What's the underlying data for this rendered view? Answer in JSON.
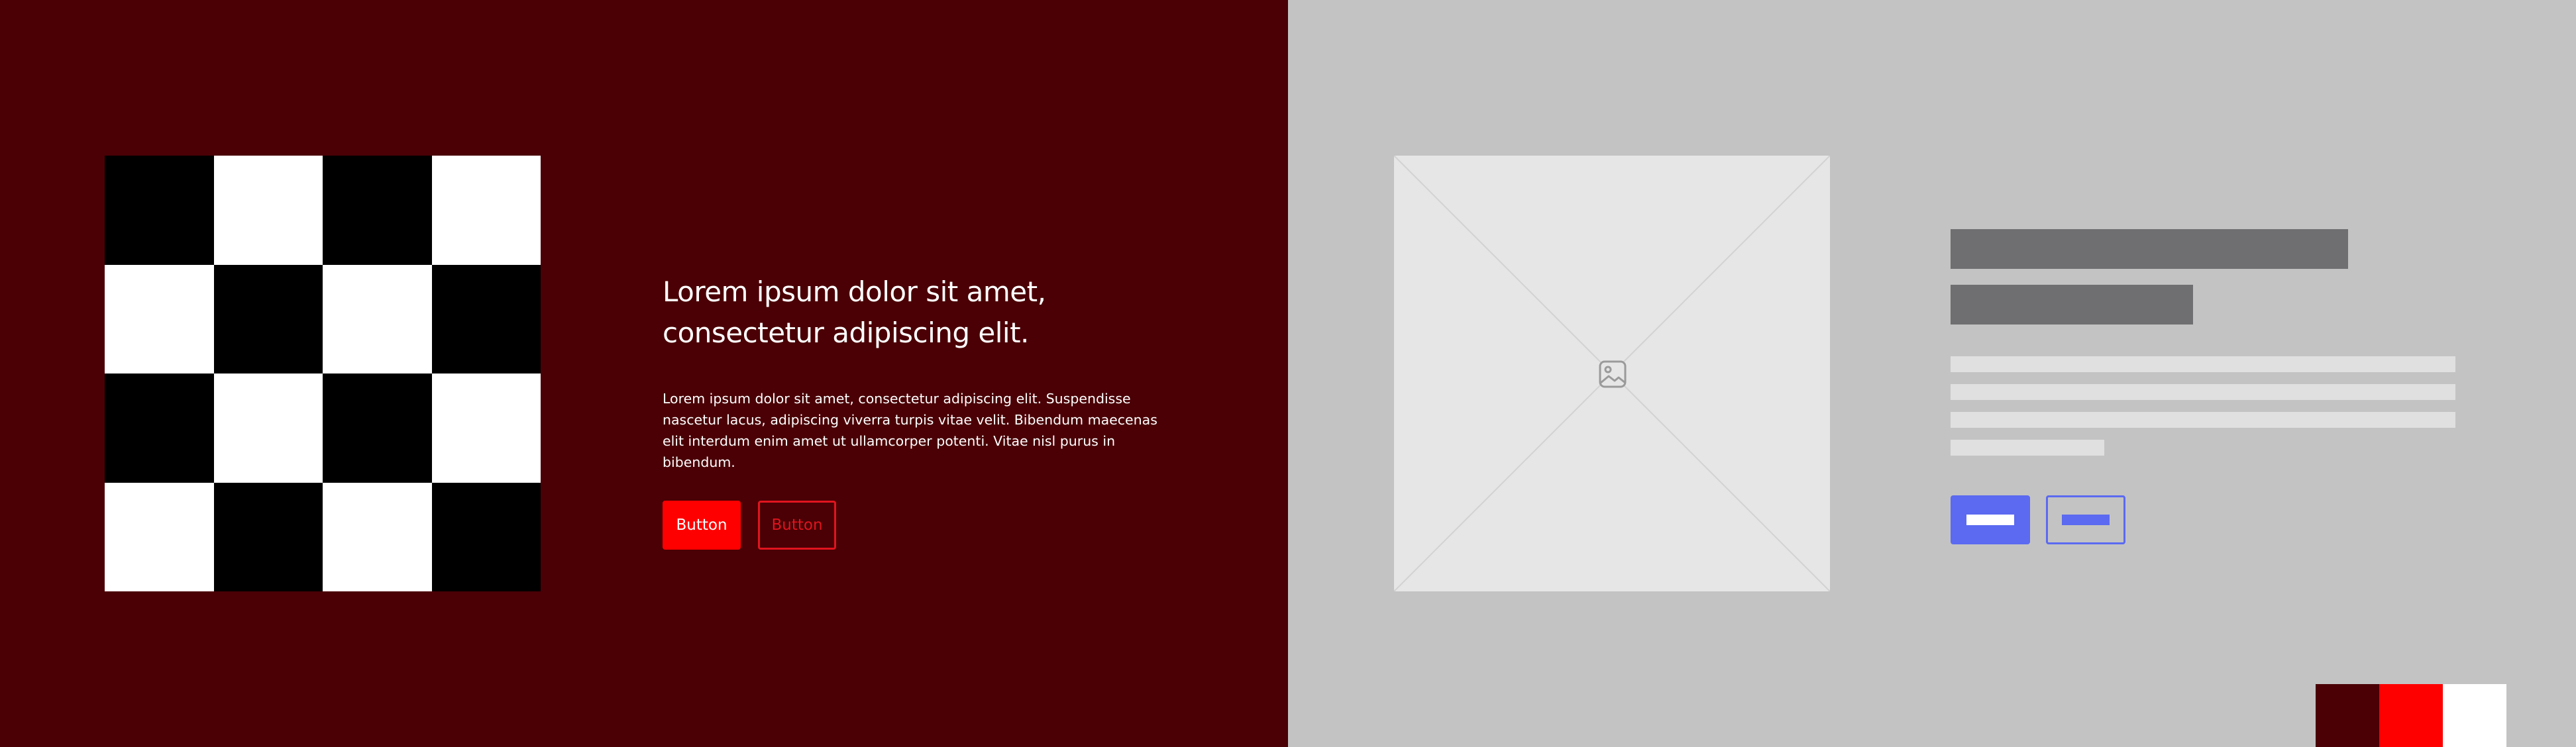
{
  "hero": {
    "headline": "Lorem ipsum dolor sit amet, consectetur adipiscing elit.",
    "body": "Lorem ipsum dolor sit amet, consectetur adipiscing elit. Suspendisse nascetur lacus, adipiscing viverra turpis vitae velit. Bibendum maecenas elit interdum enim amet ut ullamcorper potenti. Vitae nisl purus in bibendum.",
    "primary_button_label": "Button",
    "secondary_button_label": "Button"
  },
  "colors": {
    "background_dark": "#4a0005",
    "accent_red": "#ff0000",
    "text_white": "#ffffff",
    "wireframe_background": "#c3c3c3",
    "wireframe_accent": "#5b6af0"
  },
  "checkerboard": {
    "rows": 4,
    "columns": 4,
    "first_cell": "black"
  },
  "wireframe": {
    "image_placeholder_icon": "image-icon"
  },
  "palette": {
    "swatches": [
      "#4a0005",
      "#ff0000",
      "#ffffff"
    ]
  }
}
